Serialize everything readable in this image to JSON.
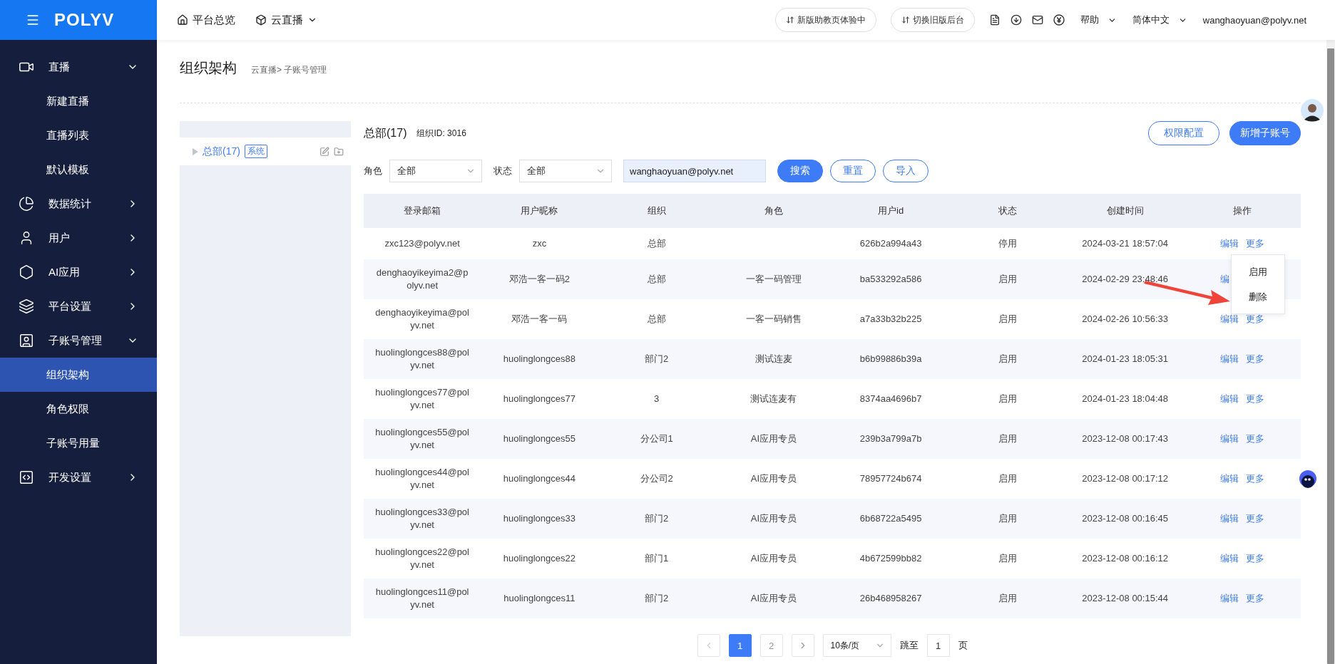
{
  "topbar": {
    "logo": "POLYV",
    "nav": [
      {
        "label": "平台总览",
        "dropdown": false
      },
      {
        "label": "云直播",
        "dropdown": true
      }
    ],
    "pills": [
      "新版助教页体验中",
      "切换旧版后台"
    ],
    "menus": [
      "帮助",
      "简体中文"
    ],
    "account": "wanghaoyuan@polyv.net"
  },
  "sidebar": [
    {
      "label": "直播",
      "expanded": true,
      "children": [
        {
          "label": "新建直播",
          "selected": false
        },
        {
          "label": "直播列表",
          "selected": false
        },
        {
          "label": "默认模板",
          "selected": false
        }
      ]
    },
    {
      "label": "数据统计",
      "expanded": false
    },
    {
      "label": "用户",
      "expanded": false
    },
    {
      "label": "AI应用",
      "expanded": false
    },
    {
      "label": "平台设置",
      "expanded": false
    },
    {
      "label": "子账号管理",
      "expanded": true,
      "children": [
        {
          "label": "组织架构",
          "selected": true
        },
        {
          "label": "角色权限",
          "selected": false
        },
        {
          "label": "子账号用量",
          "selected": false
        }
      ]
    },
    {
      "label": "开发设置",
      "expanded": false
    }
  ],
  "page": {
    "title": "组织架构",
    "breadcrumb": "云直播> 子账号管理"
  },
  "tree": [
    {
      "label": "总部(17)",
      "tag": "系统",
      "selected": true
    }
  ],
  "org": {
    "name": "总部(17)",
    "org_id": "组织ID: 3016",
    "buttons": [
      {
        "label": "权限配置",
        "primary": false
      },
      {
        "label": "新增子账号",
        "primary": true
      }
    ]
  },
  "filters": [
    {
      "label": "角色",
      "value": "全部"
    },
    {
      "label": "状态",
      "value": "全部"
    }
  ],
  "search": {
    "value": "wanghaoyuan@polyv.net"
  },
  "filter_buttons": [
    {
      "label": "搜索",
      "primary": true
    },
    {
      "label": "重置",
      "primary": false
    },
    {
      "label": "导入",
      "primary": false
    }
  ],
  "table": {
    "columns": [
      "登录邮箱",
      "用户昵称",
      "组织",
      "角色",
      "用户id",
      "状态",
      "创建时间",
      "操作"
    ],
    "rows": [
      {
        "cells": [
          "zxc123@polyv.net",
          "zxc",
          "总部",
          null,
          "626b2a994a43",
          "停用",
          "2024-03-21 18:57:04"
        ],
        "actions": [
          "编辑",
          "更多"
        ]
      },
      {
        "cells": [
          "denghaoyikeyima2@polyv.net",
          "邓浩一客一码2",
          "总部",
          "一客一码管理",
          "ba533292a586",
          "启用",
          "2024-02-29 23:48:46"
        ],
        "actions": [
          "编"
        ]
      },
      {
        "cells": [
          "denghaoyikeyima@polyv.net",
          "邓浩一客一码",
          "总部",
          "一客一码销售",
          "a7a33b32b225",
          "启用",
          "2024-02-26 10:56:33"
        ],
        "actions": [
          "编辑",
          "更多"
        ]
      },
      {
        "cells": [
          "huolinglongces88@polyv.net",
          "huolinglongces88",
          "部门2",
          "测试连麦",
          "b6b99886b39a",
          "启用",
          "2024-01-23 18:05:31"
        ],
        "actions": [
          "编辑",
          "更多"
        ]
      },
      {
        "cells": [
          "huolinglongces77@polyv.net",
          "huolinglongces77",
          "3",
          "测试连麦有",
          "8374aa4696b7",
          "启用",
          "2024-01-23 18:04:48"
        ],
        "actions": [
          "编辑",
          "更多"
        ]
      },
      {
        "cells": [
          "huolinglongces55@polyv.net",
          "huolinglongces55",
          "分公司1",
          "AI应用专员",
          "239b3a799a7b",
          "启用",
          "2023-12-08 00:17:43"
        ],
        "actions": [
          "编辑",
          "更多"
        ]
      },
      {
        "cells": [
          "huolinglongces44@polyv.net",
          "huolinglongces44",
          "分公司2",
          "AI应用专员",
          "78957724b674",
          "启用",
          "2023-12-08 00:17:12"
        ],
        "actions": [
          "编辑",
          "更多"
        ]
      },
      {
        "cells": [
          "huolinglongces33@polyv.net",
          "huolinglongces33",
          "部门2",
          "AI应用专员",
          "6b68722a5495",
          "启用",
          "2023-12-08 00:16:45"
        ],
        "actions": [
          "编辑",
          "更多"
        ]
      },
      {
        "cells": [
          "huolinglongces22@polyv.net",
          "huolinglongces22",
          "部门1",
          "AI应用专员",
          "4b672599bb82",
          "启用",
          "2023-12-08 00:16:12"
        ],
        "actions": [
          "编辑",
          "更多"
        ]
      },
      {
        "cells": [
          "huolinglongces11@polyv.net",
          "huolinglongces11",
          "部门2",
          "AI应用专员",
          "26b468958267",
          "启用",
          "2023-12-08 00:15:44"
        ],
        "actions": [
          "编辑",
          "更多"
        ]
      }
    ]
  },
  "menu": {
    "items": [
      "启用",
      "删除"
    ]
  },
  "pagination": {
    "pages": [
      {
        "label": "1",
        "selected": true
      },
      {
        "label": "2",
        "selected": false
      }
    ],
    "page_size": "10条/页",
    "jump_label": "跳至",
    "jump_value": "1",
    "jump_suffix": "页"
  }
}
